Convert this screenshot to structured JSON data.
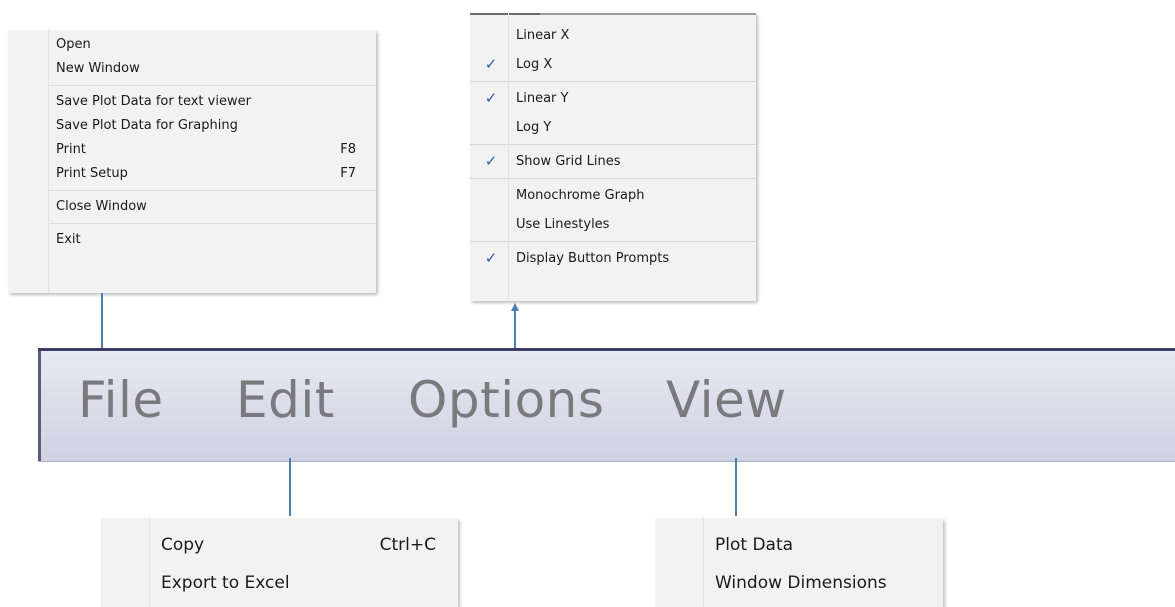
{
  "menubar": {
    "file_label": "File",
    "edit_label": "Edit",
    "options_label": "Options",
    "view_label": "View"
  },
  "file_menu": {
    "items": [
      {
        "label": "Open",
        "accel": ""
      },
      {
        "label": "New Window",
        "accel": ""
      },
      {
        "label": "Save Plot Data for text viewer",
        "accel": ""
      },
      {
        "label": "Save Plot Data for Graphing",
        "accel": ""
      },
      {
        "label": "Print",
        "accel": "F8"
      },
      {
        "label": "Print Setup",
        "accel": "F7"
      },
      {
        "label": "Close Window",
        "accel": ""
      },
      {
        "label": "Exit",
        "accel": ""
      }
    ]
  },
  "options_menu": {
    "check_glyph": "✓",
    "items": [
      {
        "label": "Linear X",
        "checked": false
      },
      {
        "label": "Log X",
        "checked": true
      },
      {
        "label": "Linear Y",
        "checked": true
      },
      {
        "label": "Log Y",
        "checked": false
      },
      {
        "label": "Show Grid Lines",
        "checked": true
      },
      {
        "label": "Monochrome Graph",
        "checked": false
      },
      {
        "label": "Use Linestyles",
        "checked": false
      },
      {
        "label": "Display Button Prompts",
        "checked": true
      }
    ]
  },
  "edit_menu": {
    "items": [
      {
        "label": "Copy",
        "accel": "Ctrl+C"
      },
      {
        "label": "Export to Excel",
        "accel": ""
      }
    ]
  },
  "view_menu": {
    "items": [
      {
        "label": "Plot Data"
      },
      {
        "label": "Window Dimensions"
      }
    ]
  },
  "colors": {
    "connector": "#4d7fb0",
    "check": "#2f5fa8",
    "menubar_text": "#7a7a7e"
  }
}
